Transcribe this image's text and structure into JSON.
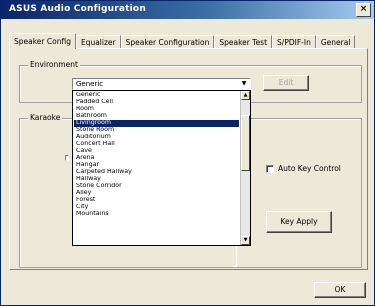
{
  "window": {
    "title": "ASUS Audio Configuration",
    "close_glyph": "×"
  },
  "tabs": [
    {
      "label": "Speaker Config"
    },
    {
      "label": "Equalizer"
    },
    {
      "label": "Speaker Configuration"
    },
    {
      "label": "Speaker Test"
    },
    {
      "label": "S/PDIF-In"
    },
    {
      "label": "General"
    }
  ],
  "environment": {
    "group_label": "Environment",
    "selected": "Generic",
    "edit_button": "Edit"
  },
  "karaoke": {
    "group_label": "Karaoke",
    "auto_key_control_label": "Auto Key Control",
    "apply_button": "Key Apply"
  },
  "dropdown": {
    "options": [
      "Generic",
      "Padded Cell",
      "Room",
      "Bathroom",
      "Livingroom",
      "Stone Room",
      "Auditorium",
      "Concert Hall",
      "Cave",
      "Arena",
      "Hangar",
      "Carpeted Hallway",
      "Hallway",
      "Stone Corridor",
      "Alley",
      "Forest",
      "City",
      "Mountains"
    ],
    "selected_index": 4
  },
  "footer": {
    "ok_button": "OK"
  }
}
